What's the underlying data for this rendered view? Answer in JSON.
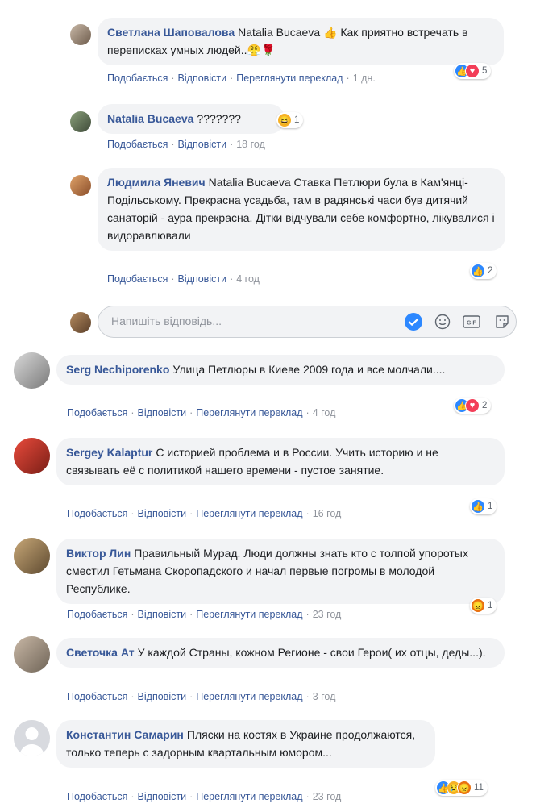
{
  "comments": [
    {
      "author": "Светлана Шаповалова",
      "text": "Natalia Bucaeva 👍 Как приятно встречать в переписках умных людей..😤🌹",
      "actions": [
        "Подобається",
        "Відповісти",
        "Переглянути переклад"
      ],
      "time": "1 дн.",
      "reactions": {
        "icons": [
          "like-icon",
          "love-icon"
        ],
        "count": "5"
      }
    },
    {
      "author": "Natalia Bucaeva",
      "text": "???????",
      "actions": [
        "Подобається",
        "Відповісти"
      ],
      "time": "18 год",
      "reactions": {
        "icons": [
          "haha-icon"
        ],
        "count": "1"
      }
    },
    {
      "author": "Людмила Яневич",
      "text": "Natalia Bucaeva Ставка Петлюри була в Кам'янці-Подільському. Прекрасна усадьба, там в радянські часи був дитячий санаторій - аура прекрасна. Дітки відчували себе комфортно, лікувалися і видоравлювали",
      "actions": [
        "Подобається",
        "Відповісти"
      ],
      "time": "4 год",
      "reactions": {
        "icons": [
          "like-icon"
        ],
        "count": "2"
      }
    },
    {
      "author": "Serg Nechiporenko",
      "text": "Улица Петлюры в Киеве 2009 года и все молчали....",
      "actions": [
        "Подобається",
        "Відповісти",
        "Переглянути переклад"
      ],
      "time": "4 год",
      "reactions": {
        "icons": [
          "like-icon",
          "love-icon"
        ],
        "count": "2"
      }
    },
    {
      "author": "Sergey Kalaptur",
      "text": "С историей проблема и в России. Учить историю и не связывать её с политикой нашего времени - пустое занятие.",
      "actions": [
        "Подобається",
        "Відповісти",
        "Переглянути переклад"
      ],
      "time": "16 год",
      "reactions": {
        "icons": [
          "like-icon"
        ],
        "count": "1"
      }
    },
    {
      "author": "Виктор Лин",
      "text": "Правильный Мурад. Люди должны знать кто с толпой упоротых сместил Гетьмана Скоропадского и начал первые погромы в молодой Республике.",
      "actions": [
        "Подобається",
        "Відповісти",
        "Переглянути переклад"
      ],
      "time": "23 год",
      "reactions": {
        "icons": [
          "angry-icon"
        ],
        "count": "1"
      }
    },
    {
      "author": "Светочка Ат",
      "text": "У каждой Страны, кожном Регионе - свои Герои( их отцы, деды...).",
      "actions": [
        "Подобається",
        "Відповісти",
        "Переглянути переклад"
      ],
      "time": "3 год",
      "reactions": null
    },
    {
      "author": "Константин Самарин",
      "text": "Пляски на костях в Украине продолжаются, только теперь с задорным квартальным юмором...",
      "actions": [
        "Подобається",
        "Відповісти",
        "Переглянути переклад"
      ],
      "time": "23 год",
      "reactions": {
        "icons": [
          "like-icon",
          "sad-icon",
          "angry-icon"
        ],
        "count": "11"
      }
    }
  ],
  "reply": {
    "placeholder": "Напишіть відповідь..."
  },
  "colors": {
    "link": "#385898",
    "bubble": "#f2f3f5",
    "muted": "#90949c",
    "like": "#2d88ff",
    "love": "#f33e58",
    "angry": "#e9710f"
  }
}
